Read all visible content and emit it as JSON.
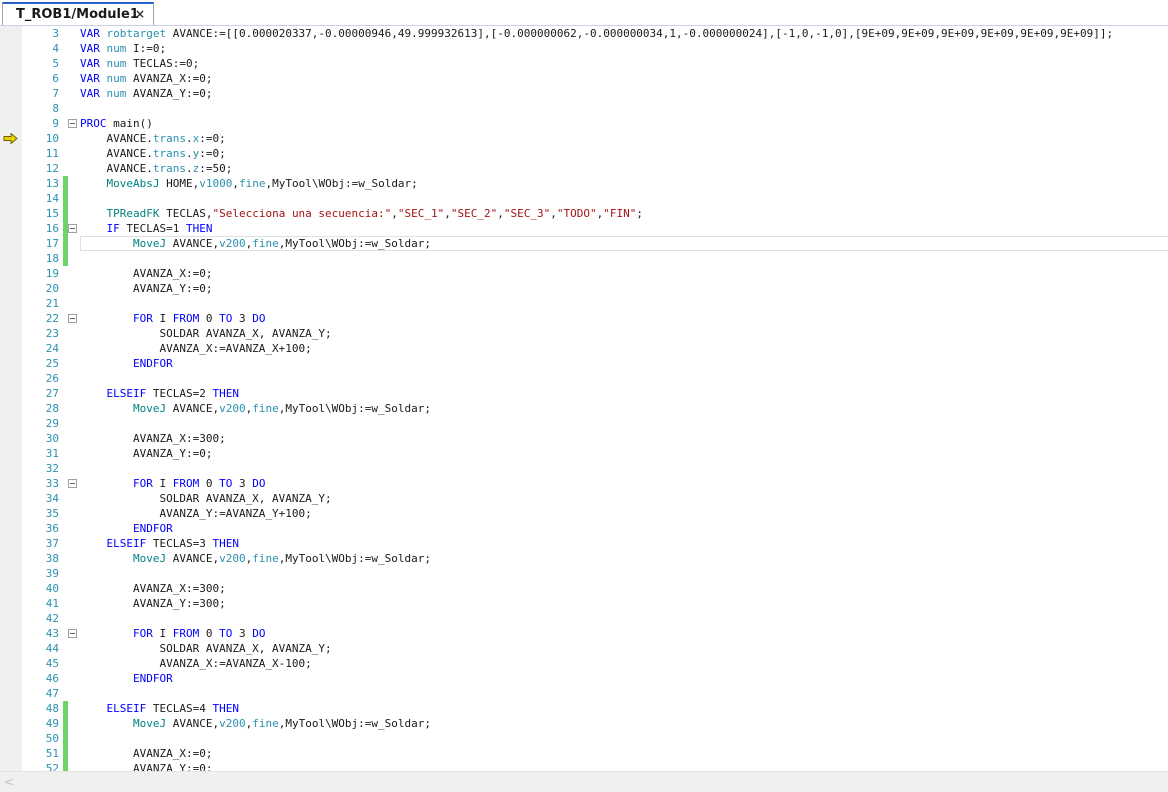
{
  "tab": {
    "title": "T_ROB1/Module1",
    "close_glyph": "×"
  },
  "colors": {
    "keyword": "#0000ff",
    "type": "#2b91af",
    "string": "#a31515",
    "line_number": "#2b91af",
    "change_bar": "#6cd46c",
    "exec_arrow": "#e8d200"
  },
  "editor": {
    "current_line": 17,
    "execution_line": 10,
    "lines": [
      {
        "n": "3",
        "fold": false,
        "changed": false,
        "code": [
          [
            "kw",
            "VAR "
          ],
          [
            "ty",
            "robtarget"
          ],
          [
            "p",
            " AVANCE:=[[0.000020337,-0.00000946,49.999932613],[-0.000000062,-0.000000034,1,-0.000000024],[-1,0,-1,0],[9E+09,9E+09,9E+09,9E+09,9E+09,9E+09]];"
          ]
        ]
      },
      {
        "n": "4",
        "fold": false,
        "changed": false,
        "code": [
          [
            "kw",
            "VAR "
          ],
          [
            "ty",
            "num"
          ],
          [
            "p",
            " I:=0;"
          ]
        ]
      },
      {
        "n": "5",
        "fold": false,
        "changed": false,
        "code": [
          [
            "kw",
            "VAR "
          ],
          [
            "ty",
            "num"
          ],
          [
            "p",
            " TECLAS:=0;"
          ]
        ]
      },
      {
        "n": "6",
        "fold": false,
        "changed": false,
        "code": [
          [
            "kw",
            "VAR "
          ],
          [
            "ty",
            "num"
          ],
          [
            "p",
            " AVANZA_X:=0;"
          ]
        ]
      },
      {
        "n": "7",
        "fold": false,
        "changed": false,
        "code": [
          [
            "kw",
            "VAR "
          ],
          [
            "ty",
            "num"
          ],
          [
            "p",
            " AVANZA_Y:=0;"
          ]
        ]
      },
      {
        "n": "8",
        "fold": false,
        "changed": false,
        "code": []
      },
      {
        "n": "9",
        "fold": true,
        "changed": false,
        "code": [
          [
            "kw",
            "PROC"
          ],
          [
            "p",
            " main()"
          ]
        ]
      },
      {
        "n": "10",
        "fold": false,
        "changed": false,
        "code": [
          [
            "p",
            "    AVANCE."
          ],
          [
            "ty",
            "trans"
          ],
          [
            "p",
            "."
          ],
          [
            "ty",
            "x"
          ],
          [
            "p",
            ":=0;"
          ]
        ]
      },
      {
        "n": "11",
        "fold": false,
        "changed": false,
        "code": [
          [
            "p",
            "    AVANCE."
          ],
          [
            "ty",
            "trans"
          ],
          [
            "p",
            "."
          ],
          [
            "ty",
            "y"
          ],
          [
            "p",
            ":=0;"
          ]
        ]
      },
      {
        "n": "12",
        "fold": false,
        "changed": false,
        "code": [
          [
            "p",
            "    AVANCE."
          ],
          [
            "ty",
            "trans"
          ],
          [
            "p",
            "."
          ],
          [
            "ty",
            "z"
          ],
          [
            "p",
            ":=50;"
          ]
        ]
      },
      {
        "n": "13",
        "fold": false,
        "changed": true,
        "code": [
          [
            "fn",
            "    MoveAbsJ"
          ],
          [
            "p",
            " HOME,"
          ],
          [
            "ty",
            "v1000"
          ],
          [
            "p",
            ","
          ],
          [
            "ty",
            "fine"
          ],
          [
            "p",
            ",MyTool\\WObj:=w_Soldar;"
          ]
        ]
      },
      {
        "n": "14",
        "fold": false,
        "changed": true,
        "code": []
      },
      {
        "n": "15",
        "fold": false,
        "changed": true,
        "code": [
          [
            "fn",
            "    TPReadFK"
          ],
          [
            "p",
            " TECLAS,"
          ],
          [
            "str",
            "\"Selecciona una secuencia:\""
          ],
          [
            "p",
            ","
          ],
          [
            "str",
            "\"SEC_1\""
          ],
          [
            "p",
            ","
          ],
          [
            "str",
            "\"SEC_2\""
          ],
          [
            "p",
            ","
          ],
          [
            "str",
            "\"SEC_3\""
          ],
          [
            "p",
            ","
          ],
          [
            "str",
            "\"TODO\""
          ],
          [
            "p",
            ","
          ],
          [
            "str",
            "\"FIN\""
          ],
          [
            "p",
            ";"
          ]
        ]
      },
      {
        "n": "16",
        "fold": true,
        "changed": true,
        "code": [
          [
            "kw",
            "    IF"
          ],
          [
            "p",
            " TECLAS=1 "
          ],
          [
            "kw",
            "THEN"
          ]
        ]
      },
      {
        "n": "17",
        "fold": false,
        "changed": true,
        "code": [
          [
            "fn",
            "        MoveJ"
          ],
          [
            "p",
            " AVANCE,"
          ],
          [
            "ty",
            "v200"
          ],
          [
            "p",
            ","
          ],
          [
            "ty",
            "fine"
          ],
          [
            "p",
            ",MyTool\\WObj:=w_Soldar;"
          ]
        ]
      },
      {
        "n": "18",
        "fold": false,
        "changed": true,
        "code": []
      },
      {
        "n": "19",
        "fold": false,
        "changed": false,
        "code": [
          [
            "p",
            "        AVANZA_X:=0;"
          ]
        ]
      },
      {
        "n": "20",
        "fold": false,
        "changed": false,
        "code": [
          [
            "p",
            "        AVANZA_Y:=0;"
          ]
        ]
      },
      {
        "n": "21",
        "fold": false,
        "changed": false,
        "code": []
      },
      {
        "n": "22",
        "fold": true,
        "changed": false,
        "code": [
          [
            "kw",
            "        FOR"
          ],
          [
            "p",
            " I "
          ],
          [
            "kw",
            "FROM"
          ],
          [
            "p",
            " 0 "
          ],
          [
            "kw",
            "TO"
          ],
          [
            "p",
            " 3 "
          ],
          [
            "kw",
            "DO"
          ]
        ]
      },
      {
        "n": "23",
        "fold": false,
        "changed": false,
        "code": [
          [
            "p",
            "            SOLDAR AVANZA_X, AVANZA_Y;"
          ]
        ]
      },
      {
        "n": "24",
        "fold": false,
        "changed": false,
        "code": [
          [
            "p",
            "            AVANZA_X:=AVANZA_X+100;"
          ]
        ]
      },
      {
        "n": "25",
        "fold": false,
        "changed": false,
        "code": [
          [
            "kw",
            "        ENDFOR"
          ]
        ]
      },
      {
        "n": "26",
        "fold": false,
        "changed": false,
        "code": []
      },
      {
        "n": "27",
        "fold": false,
        "changed": false,
        "code": [
          [
            "kw",
            "    ELSEIF"
          ],
          [
            "p",
            " TECLAS=2 "
          ],
          [
            "kw",
            "THEN"
          ]
        ]
      },
      {
        "n": "28",
        "fold": false,
        "changed": false,
        "code": [
          [
            "fn",
            "        MoveJ"
          ],
          [
            "p",
            " AVANCE,"
          ],
          [
            "ty",
            "v200"
          ],
          [
            "p",
            ","
          ],
          [
            "ty",
            "fine"
          ],
          [
            "p",
            ",MyTool\\WObj:=w_Soldar;"
          ]
        ]
      },
      {
        "n": "29",
        "fold": false,
        "changed": false,
        "code": []
      },
      {
        "n": "30",
        "fold": false,
        "changed": false,
        "code": [
          [
            "p",
            "        AVANZA_X:=300;"
          ]
        ]
      },
      {
        "n": "31",
        "fold": false,
        "changed": false,
        "code": [
          [
            "p",
            "        AVANZA_Y:=0;"
          ]
        ]
      },
      {
        "n": "32",
        "fold": false,
        "changed": false,
        "code": []
      },
      {
        "n": "33",
        "fold": true,
        "changed": false,
        "code": [
          [
            "kw",
            "        FOR"
          ],
          [
            "p",
            " I "
          ],
          [
            "kw",
            "FROM"
          ],
          [
            "p",
            " 0 "
          ],
          [
            "kw",
            "TO"
          ],
          [
            "p",
            " 3 "
          ],
          [
            "kw",
            "DO"
          ]
        ]
      },
      {
        "n": "34",
        "fold": false,
        "changed": false,
        "code": [
          [
            "p",
            "            SOLDAR AVANZA_X, AVANZA_Y;"
          ]
        ]
      },
      {
        "n": "35",
        "fold": false,
        "changed": false,
        "code": [
          [
            "p",
            "            AVANZA_Y:=AVANZA_Y+100;"
          ]
        ]
      },
      {
        "n": "36",
        "fold": false,
        "changed": false,
        "code": [
          [
            "kw",
            "        ENDFOR"
          ]
        ]
      },
      {
        "n": "37",
        "fold": false,
        "changed": false,
        "code": [
          [
            "kw",
            "    ELSEIF"
          ],
          [
            "p",
            " TECLAS=3 "
          ],
          [
            "kw",
            "THEN"
          ]
        ]
      },
      {
        "n": "38",
        "fold": false,
        "changed": false,
        "code": [
          [
            "fn",
            "        MoveJ"
          ],
          [
            "p",
            " AVANCE,"
          ],
          [
            "ty",
            "v200"
          ],
          [
            "p",
            ","
          ],
          [
            "ty",
            "fine"
          ],
          [
            "p",
            ",MyTool\\WObj:=w_Soldar;"
          ]
        ]
      },
      {
        "n": "39",
        "fold": false,
        "changed": false,
        "code": []
      },
      {
        "n": "40",
        "fold": false,
        "changed": false,
        "code": [
          [
            "p",
            "        AVANZA_X:=300;"
          ]
        ]
      },
      {
        "n": "41",
        "fold": false,
        "changed": false,
        "code": [
          [
            "p",
            "        AVANZA_Y:=300;"
          ]
        ]
      },
      {
        "n": "42",
        "fold": false,
        "changed": false,
        "code": []
      },
      {
        "n": "43",
        "fold": true,
        "changed": false,
        "code": [
          [
            "kw",
            "        FOR"
          ],
          [
            "p",
            " I "
          ],
          [
            "kw",
            "FROM"
          ],
          [
            "p",
            " 0 "
          ],
          [
            "kw",
            "TO"
          ],
          [
            "p",
            " 3 "
          ],
          [
            "kw",
            "DO"
          ]
        ]
      },
      {
        "n": "44",
        "fold": false,
        "changed": false,
        "code": [
          [
            "p",
            "            SOLDAR AVANZA_X, AVANZA_Y;"
          ]
        ]
      },
      {
        "n": "45",
        "fold": false,
        "changed": false,
        "code": [
          [
            "p",
            "            AVANZA_X:=AVANZA_X-100;"
          ]
        ]
      },
      {
        "n": "46",
        "fold": false,
        "changed": false,
        "code": [
          [
            "kw",
            "        ENDFOR"
          ]
        ]
      },
      {
        "n": "47",
        "fold": false,
        "changed": false,
        "code": []
      },
      {
        "n": "48",
        "fold": false,
        "changed": true,
        "code": [
          [
            "kw",
            "    ELSEIF"
          ],
          [
            "p",
            " TECLAS=4 "
          ],
          [
            "kw",
            "THEN"
          ]
        ]
      },
      {
        "n": "49",
        "fold": false,
        "changed": true,
        "code": [
          [
            "fn",
            "        MoveJ"
          ],
          [
            "p",
            " AVANCE,"
          ],
          [
            "ty",
            "v200"
          ],
          [
            "p",
            ","
          ],
          [
            "ty",
            "fine"
          ],
          [
            "p",
            ",MyTool\\WObj:=w_Soldar;"
          ]
        ]
      },
      {
        "n": "50",
        "fold": false,
        "changed": true,
        "code": []
      },
      {
        "n": "51",
        "fold": false,
        "changed": true,
        "code": [
          [
            "p",
            "        AVANZA_X:=0;"
          ]
        ]
      },
      {
        "n": "52",
        "fold": false,
        "changed": true,
        "code": [
          [
            "p",
            "        AVANZA_Y:=0;"
          ]
        ]
      }
    ]
  },
  "scrollbar": {
    "left_arrow_glyph": "<"
  }
}
